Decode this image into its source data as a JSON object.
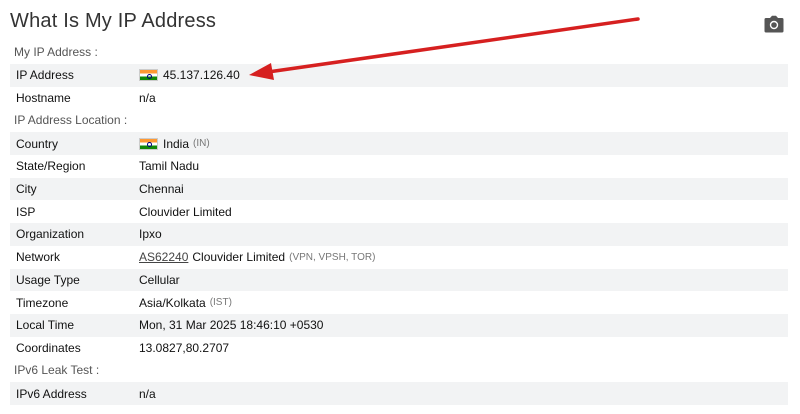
{
  "title": "What Is My IP Address",
  "icons": {
    "camera": "camera-icon",
    "flag": "india-flag-icon",
    "arrow": "red-arrow"
  },
  "colors": {
    "arrow": "#d62020",
    "row_shade": "#f2f3f4",
    "muted": "#777777"
  },
  "sections": {
    "my_ip": "My IP Address :",
    "location": "IP Address Location :",
    "ipv6": "IPv6 Leak Test :"
  },
  "rows": {
    "ip_address": {
      "label": "IP Address",
      "value": "45.137.126.40"
    },
    "hostname": {
      "label": "Hostname",
      "value": "n/a"
    },
    "country": {
      "label": "Country",
      "value": "India",
      "code": "(IN)"
    },
    "state": {
      "label": "State/Region",
      "value": "Tamil Nadu"
    },
    "city": {
      "label": "City",
      "value": "Chennai"
    },
    "isp": {
      "label": "ISP",
      "value": "Clouvider Limited"
    },
    "organization": {
      "label": "Organization",
      "value": "Ipxo"
    },
    "network": {
      "label": "Network",
      "asn": "AS62240",
      "value": "Clouvider Limited",
      "tags": "(VPN, VPSH, TOR)"
    },
    "usage_type": {
      "label": "Usage Type",
      "value": "Cellular"
    },
    "timezone": {
      "label": "Timezone",
      "value": "Asia/Kolkata",
      "abbr": "(IST)"
    },
    "local_time": {
      "label": "Local Time",
      "value": "Mon, 31 Mar 2025 18:46:10 +0530"
    },
    "coordinates": {
      "label": "Coordinates",
      "value": "13.0827,80.2707"
    },
    "ipv6_address": {
      "label": "IPv6 Address",
      "value": "n/a"
    }
  }
}
